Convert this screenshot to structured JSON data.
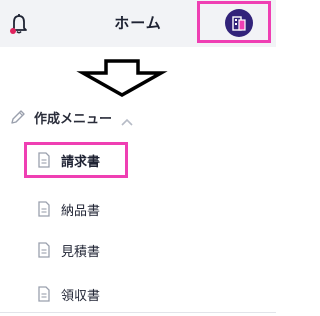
{
  "header": {
    "title": "ホーム",
    "bell_icon": "bell-icon",
    "avatar_icon": "building-avatar-icon",
    "highlight_color": "#ef3fb3",
    "notification_dot_color": "#e0245e",
    "avatar_color": "#32237a"
  },
  "annotation": {
    "arrow_icon": "down-arrow-outline-icon"
  },
  "menu": {
    "section_label": "作成メニュー",
    "section_icon": "pencil-icon",
    "collapse_icon": "chevron-up-icon",
    "items": [
      {
        "label": "請求書",
        "icon": "document-icon",
        "highlighted": true
      },
      {
        "label": "納品書",
        "icon": "document-icon",
        "highlighted": false
      },
      {
        "label": "見積書",
        "icon": "document-icon",
        "highlighted": false
      },
      {
        "label": "領収書",
        "icon": "document-icon",
        "highlighted": false
      }
    ]
  }
}
